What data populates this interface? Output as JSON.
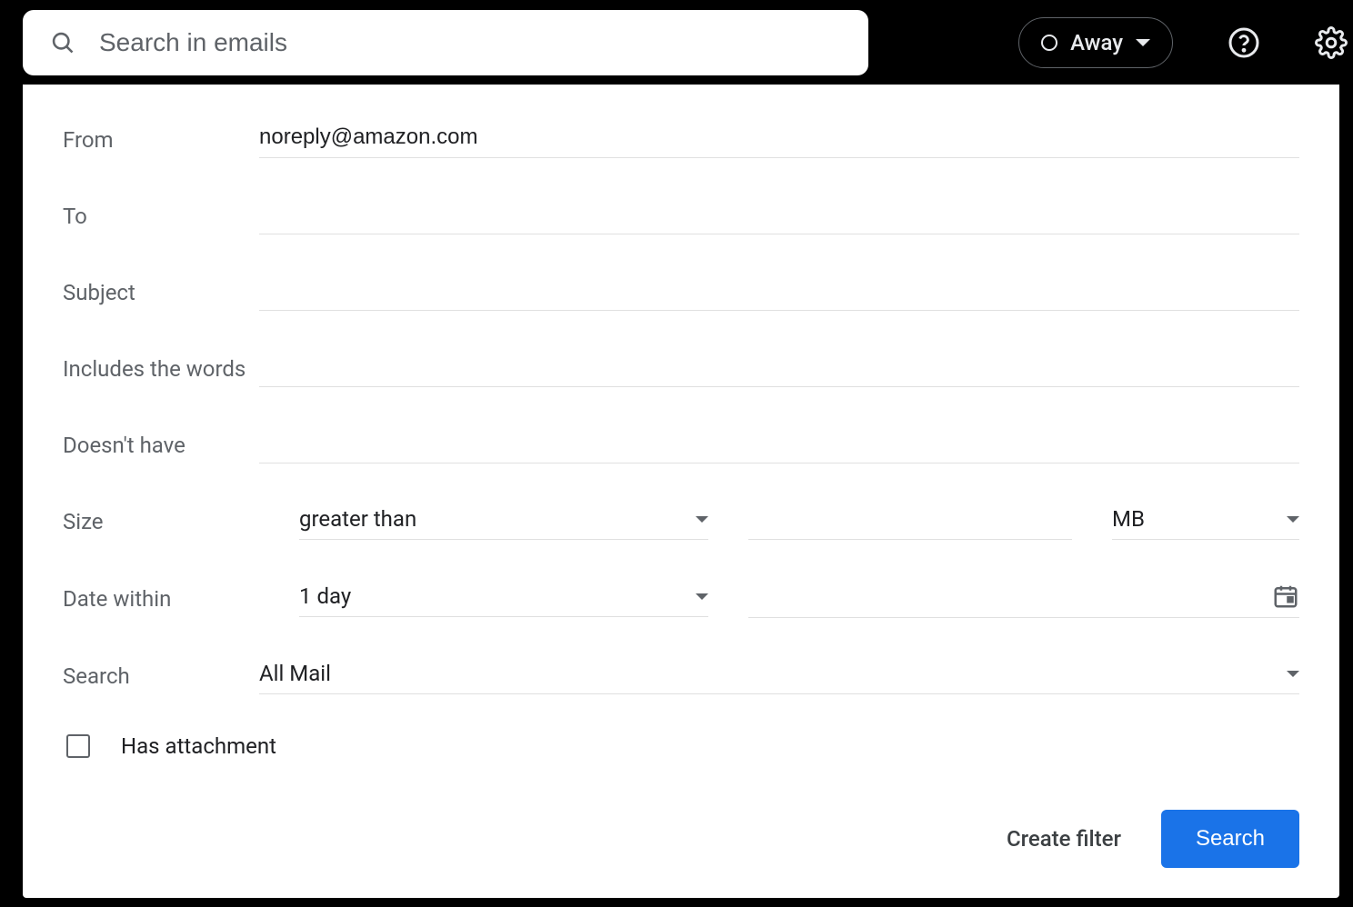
{
  "header": {
    "search_placeholder": "Search in emails",
    "status_label": "Away"
  },
  "form": {
    "labels": {
      "from": "From",
      "to": "To",
      "subject": "Subject",
      "includes": "Includes the words",
      "doesnt_have": "Doesn't have",
      "size": "Size",
      "date_within": "Date within",
      "search": "Search",
      "has_attachment": "Has attachment"
    },
    "values": {
      "from": "noreply@amazon.com",
      "to": "",
      "subject": "",
      "includes": "",
      "doesnt_have": "",
      "size_comparator": "greater than",
      "size_value": "",
      "size_unit": "MB",
      "date_range": "1 day",
      "date_value": "",
      "search_scope": "All Mail",
      "has_attachment": false
    }
  },
  "buttons": {
    "create_filter": "Create filter",
    "search": "Search"
  }
}
